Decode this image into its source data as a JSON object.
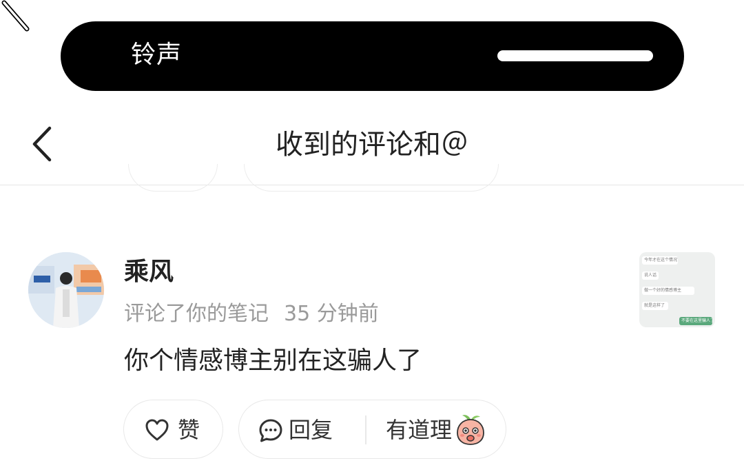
{
  "status": {
    "mode_label": "铃声",
    "icon": "bell-muted-icon"
  },
  "nav": {
    "title": "收到的评论和＠",
    "back_icon": "chevron-left-icon"
  },
  "notification": {
    "username": "乘风",
    "action": "评论了你的笔记",
    "time": "35 分钟前",
    "comment_text": "你个情感博主别在这骗人了",
    "thumbnail_lines": [
      "今年才在这个情况下",
      "说人话",
      "做一个好的情感博主",
      "就是这样了",
      "不要在这里骗人了"
    ]
  },
  "actions": {
    "like_label": "赞",
    "reply_label": "回复",
    "reaction_label": "有道理",
    "like_icon": "heart-outline-icon",
    "reply_icon": "chat-bubble-icon",
    "reaction_icon": "peach-emoji-icon"
  },
  "colors": {
    "status_pill": "#000000",
    "text_primary": "#222222",
    "text_secondary": "#9a9a9a",
    "divider": "#e6e6e6",
    "thumb_accent": "#5aa87c"
  }
}
